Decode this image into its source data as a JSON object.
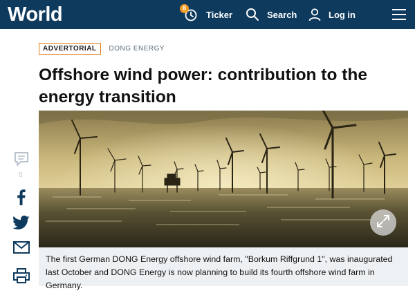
{
  "header": {
    "logo": "World",
    "ticker_label": "Ticker",
    "ticker_badge": "8",
    "search_label": "Search",
    "login_label": "Log in",
    "menu_icon": "hamburger-icon"
  },
  "article": {
    "tag": "ADVERTORIAL",
    "sponsor": "DONG ENERGY",
    "headline": "Offshore wind power: contribution to the energy transition",
    "caption": "The first German DONG Energy offshore wind farm, \"Borkum Riffgrund 1\", was inaugurated last October and DONG Energy is now planning to build its fourth offshore wind farm in Germany."
  },
  "share": {
    "comment_count": "0",
    "icons": [
      "comment-icon",
      "facebook-icon",
      "twitter-icon",
      "email-icon",
      "print-icon"
    ]
  },
  "colors": {
    "header_bg": "#0e3a5e",
    "tag_border": "#e07b14",
    "badge": "#f29b1f",
    "caption_bg": "#eef1f4"
  }
}
